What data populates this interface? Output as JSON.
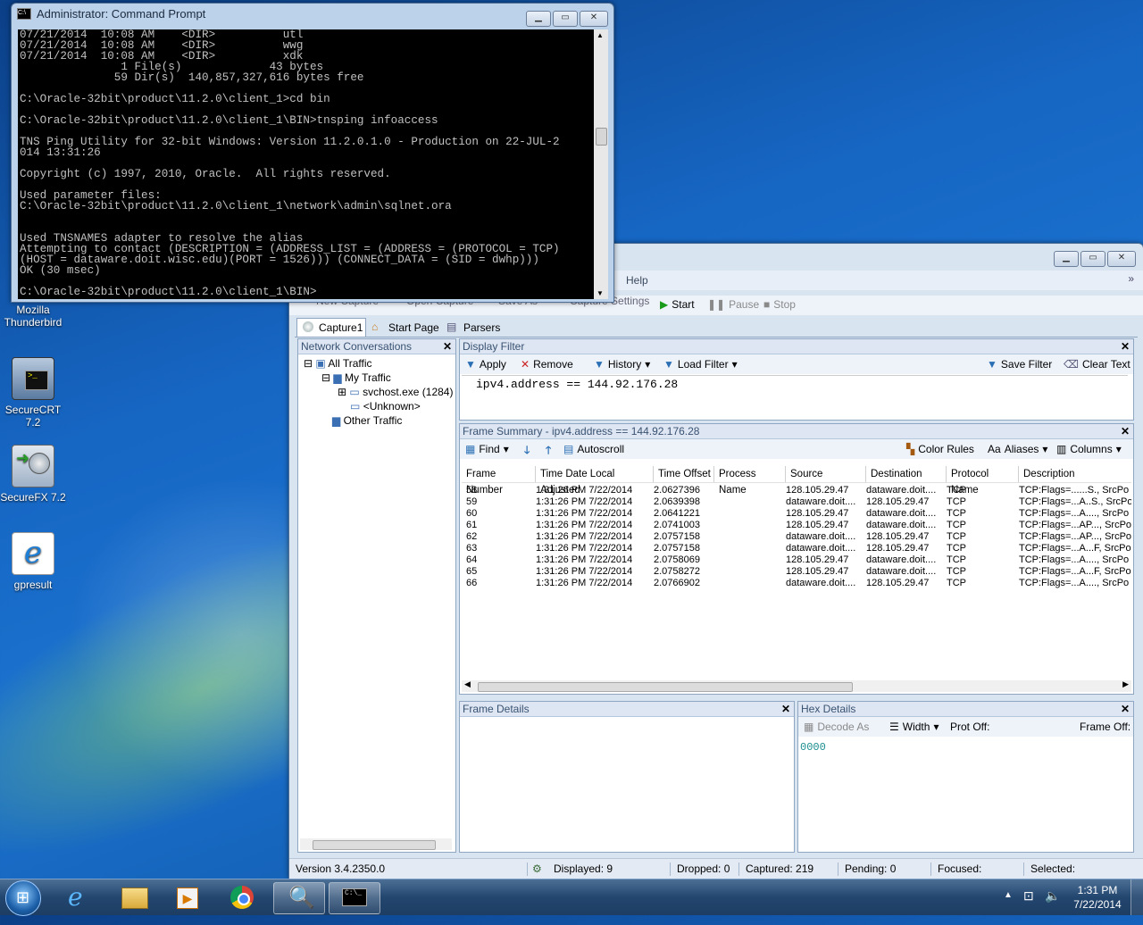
{
  "desktop": {
    "icons": [
      {
        "label_line1": "Mozilla",
        "label_line2": "Thunderbird"
      },
      {
        "label_line1": "SecureCRT",
        "label_line2": "7.2"
      },
      {
        "label_line1": "SecureFX 7.2",
        "label_line2": ""
      },
      {
        "label_line1": "gpresult",
        "label_line2": ""
      }
    ]
  },
  "cmd": {
    "title": "Administrator: Command Prompt",
    "lines": [
      "07/21/2014  10:08 AM    <DIR>          utl",
      "07/21/2014  10:08 AM    <DIR>          wwg",
      "07/21/2014  10:08 AM    <DIR>          xdk",
      "               1 File(s)             43 bytes",
      "              59 Dir(s)  140,857,327,616 bytes free",
      "",
      "C:\\Oracle-32bit\\product\\11.2.0\\client_1>cd bin",
      "",
      "C:\\Oracle-32bit\\product\\11.2.0\\client_1\\BIN>tnsping infoaccess",
      "",
      "TNS Ping Utility for 32-bit Windows: Version 11.2.0.1.0 - Production on 22-JUL-2",
      "014 13:31:26",
      "",
      "Copyright (c) 1997, 2010, Oracle.  All rights reserved.",
      "",
      "Used parameter files:",
      "C:\\Oracle-32bit\\product\\11.2.0\\client_1\\network\\admin\\sqlnet.ora",
      "",
      "",
      "Used TNSNAMES adapter to resolve the alias",
      "Attempting to contact (DESCRIPTION = (ADDRESS_LIST = (ADDRESS = (PROTOCOL = TCP)",
      "(HOST = dataware.doit.wisc.edu)(PORT = 1526))) (CONNECT_DATA = (SID = dwhp)))",
      "OK (30 msec)",
      "",
      "C:\\Oracle-32bit\\product\\11.2.0\\client_1\\BIN>"
    ]
  },
  "netmon": {
    "menu_help": "Help",
    "toolbar": {
      "new_capture": "New Capture",
      "open_capture": "Open Capture",
      "save_as": "Save As",
      "capture_settings": "Capture Settings",
      "start": "Start",
      "pause": "Pause",
      "stop": "Stop"
    },
    "tabs": [
      "Capture1",
      "Start Page",
      "Parsers"
    ],
    "conversations": {
      "title": "Network Conversations",
      "all_traffic": "All Traffic",
      "my_traffic": "My Traffic",
      "svchost": "svchost.exe (1284)",
      "unknown": "<Unknown>",
      "other_traffic": "Other Traffic"
    },
    "display_filter": {
      "title": "Display Filter",
      "apply": "Apply",
      "remove": "Remove",
      "history": "History",
      "load_filter": "Load Filter",
      "save_filter": "Save Filter",
      "clear_text": "Clear Text",
      "expression": "ipv4.address == 144.92.176.28"
    },
    "frame_summary": {
      "title": "Frame Summary - ipv4.address == 144.92.176.28",
      "find": "Find",
      "autoscroll": "Autoscroll",
      "color_rules": "Color Rules",
      "aliases": "Aliases",
      "columns_btn": "Columns",
      "columns": [
        "Frame Number",
        "Time Date Local Adjusted",
        "Time Offset",
        "Process Name",
        "Source",
        "Destination",
        "Protocol Name",
        "Description"
      ],
      "rows": [
        [
          "58",
          "1:31:26 PM 7/22/2014",
          "2.0627396",
          "",
          "128.105.29.47",
          "dataware.doit....",
          "TCP",
          "TCP:Flags=......S., SrcPo"
        ],
        [
          "59",
          "1:31:26 PM 7/22/2014",
          "2.0639398",
          "",
          "dataware.doit....",
          "128.105.29.47",
          "TCP",
          "TCP:Flags=...A..S., SrcPo"
        ],
        [
          "60",
          "1:31:26 PM 7/22/2014",
          "2.0641221",
          "",
          "128.105.29.47",
          "dataware.doit....",
          "TCP",
          "TCP:Flags=...A...., SrcPo"
        ],
        [
          "61",
          "1:31:26 PM 7/22/2014",
          "2.0741003",
          "",
          "128.105.29.47",
          "dataware.doit....",
          "TCP",
          "TCP:Flags=...AP..., SrcPo"
        ],
        [
          "62",
          "1:31:26 PM 7/22/2014",
          "2.0757158",
          "",
          "dataware.doit....",
          "128.105.29.47",
          "TCP",
          "TCP:Flags=...AP..., SrcPo"
        ],
        [
          "63",
          "1:31:26 PM 7/22/2014",
          "2.0757158",
          "",
          "dataware.doit....",
          "128.105.29.47",
          "TCP",
          "TCP:Flags=...A...F, SrcPo"
        ],
        [
          "64",
          "1:31:26 PM 7/22/2014",
          "2.0758069",
          "",
          "128.105.29.47",
          "dataware.doit....",
          "TCP",
          "TCP:Flags=...A...., SrcPo"
        ],
        [
          "65",
          "1:31:26 PM 7/22/2014",
          "2.0758272",
          "",
          "128.105.29.47",
          "dataware.doit....",
          "TCP",
          "TCP:Flags=...A...F, SrcPo"
        ],
        [
          "66",
          "1:31:26 PM 7/22/2014",
          "2.0766902",
          "",
          "dataware.doit....",
          "128.105.29.47",
          "TCP",
          "TCP:Flags=...A...., SrcPo"
        ]
      ]
    },
    "frame_details": {
      "title": "Frame Details"
    },
    "hex_details": {
      "title": "Hex Details",
      "decode_as": "Decode As",
      "width": "Width",
      "prot_off": "Prot Off:",
      "frame_off": "Frame Off:",
      "offset": "0000"
    },
    "statusbar": {
      "version": "Version 3.4.2350.0",
      "displayed": "Displayed: 9",
      "dropped": "Dropped: 0",
      "captured": "Captured: 219",
      "pending": "Pending: 0",
      "focused": "Focused:",
      "selected": "Selected:"
    }
  },
  "taskbar": {
    "clock_time": "1:31 PM",
    "clock_date": "7/22/2014"
  }
}
